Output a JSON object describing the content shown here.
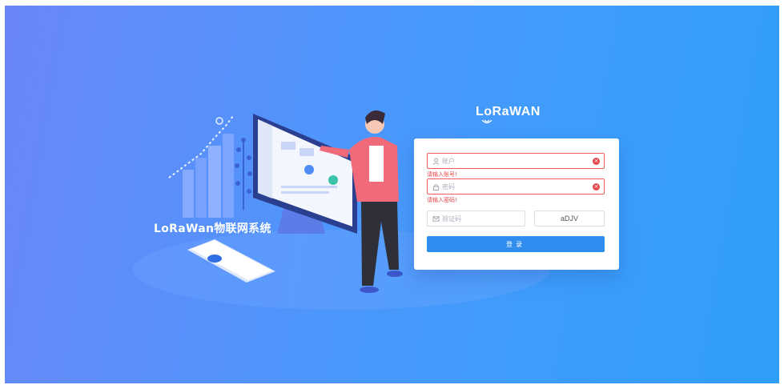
{
  "left_panel": {
    "system_title": "LoRaWan物联网系统",
    "phone_label": "LoRaWAN"
  },
  "brand": {
    "logo_text": "LoRaWAN"
  },
  "login_form": {
    "account_placeholder": "账户",
    "account_error": "请输入账号!",
    "password_placeholder": "密码",
    "password_error": "请输入密码!",
    "captcha_placeholder": "验证码",
    "captcha_code": "aDJV",
    "login_label": "登录"
  },
  "colors": {
    "background_start": "#6a86f7",
    "background_end": "#2f9ef8",
    "error": "#e5484d",
    "primary": "#2f8df0"
  }
}
